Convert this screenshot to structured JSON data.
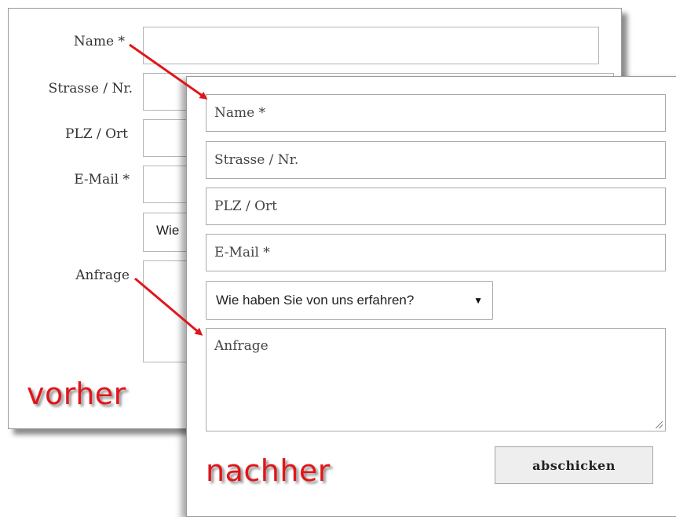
{
  "before": {
    "caption": "vorher",
    "labels": {
      "name": "Name *",
      "street": "Strasse / Nr.",
      "city": "PLZ / Ort",
      "email": "E-Mail *",
      "message": "Anfrage"
    },
    "select_partial": "Wie"
  },
  "after": {
    "caption": "nachher",
    "placeholders": {
      "name": "Name *",
      "street": "Strasse / Nr.",
      "city": "PLZ / Ort",
      "email": "E-Mail *",
      "message": "Anfrage"
    },
    "select_value": "Wie haben Sie von uns erfahren?",
    "submit_label": "abschicken"
  },
  "colors": {
    "caption": "#e0161b",
    "arrow": "#e0161b"
  },
  "icons": {
    "select_caret": "caret-down-icon",
    "resize": "resize-grip-icon"
  }
}
